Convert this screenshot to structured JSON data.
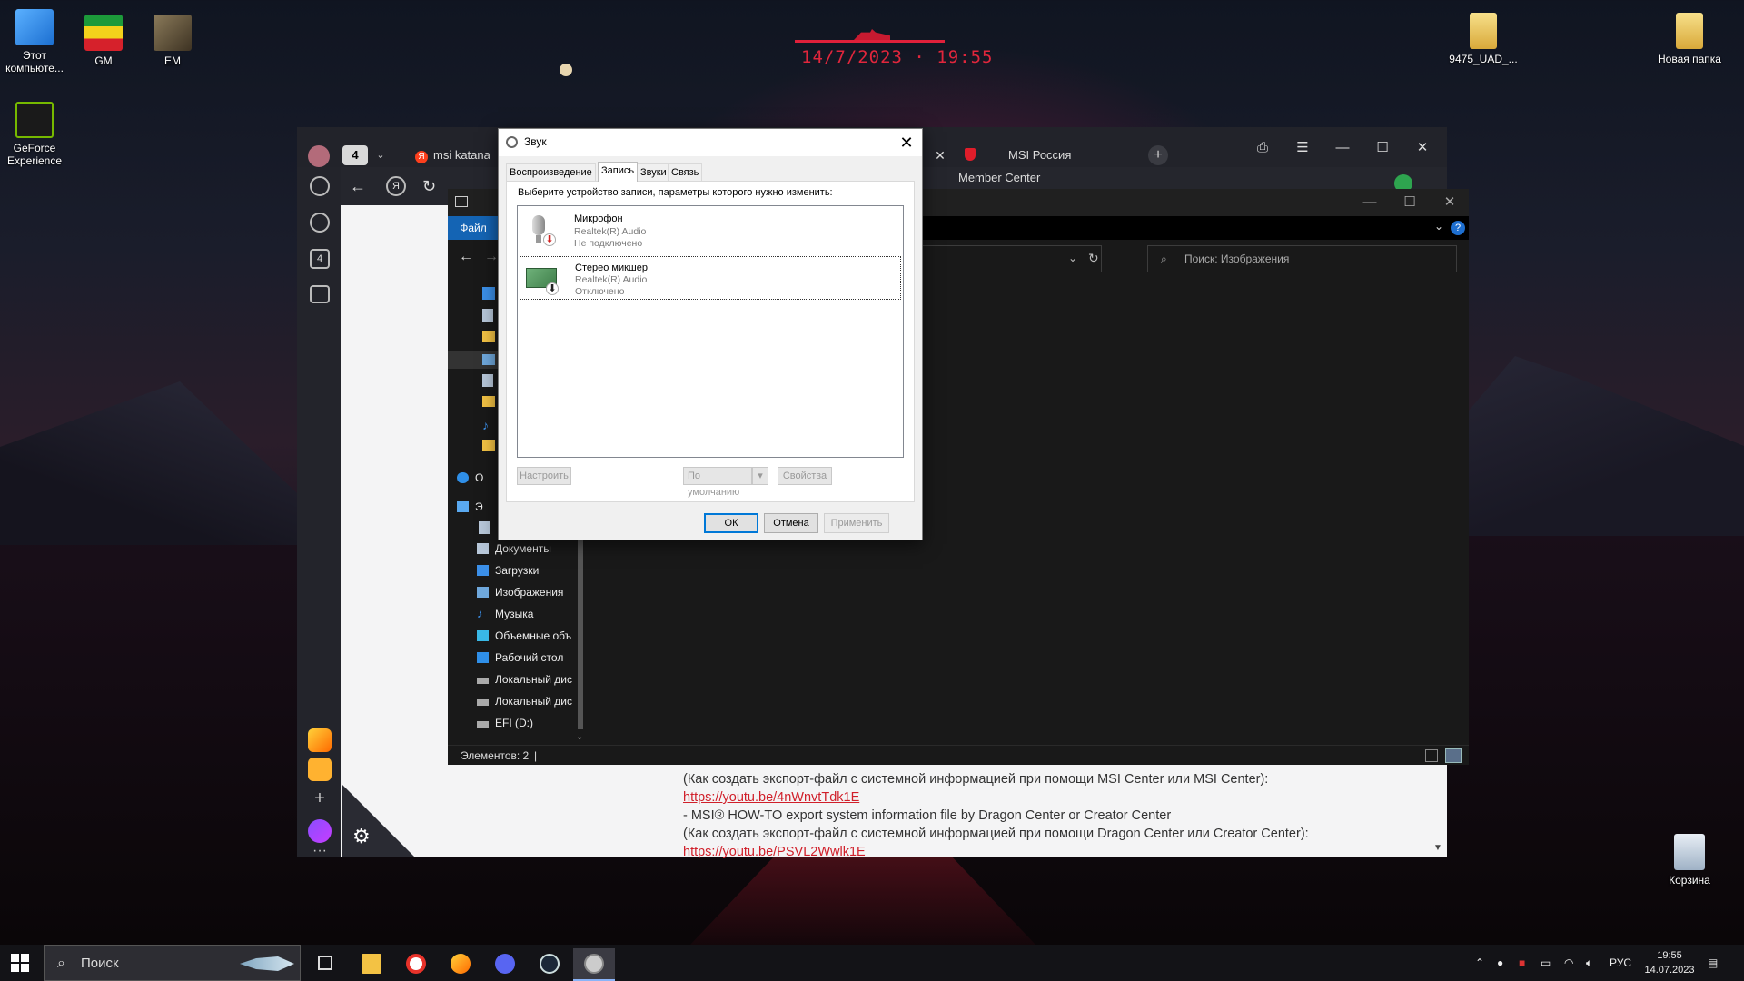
{
  "desktop": {
    "clock": "14/7/2023 · 19:55",
    "icons": [
      {
        "label": "Этот компьюте..."
      },
      {
        "label": "GM"
      },
      {
        "label": "EM"
      },
      {
        "label": "GeForce Experience"
      },
      {
        "label": "9475_UAD_..."
      },
      {
        "label": "Новая папка"
      },
      {
        "label": "Корзина"
      }
    ]
  },
  "browser": {
    "tab_count": "4",
    "tabs": [
      {
        "label": "msi katana"
      },
      {
        "label": "MSI Россия"
      }
    ],
    "partial_tab": "Member Center",
    "sidebar_badge": "4",
    "page_lines": [
      {
        "text": "(Как создать экспорт-файл с системной информацией при помощи MSI Center или MSI Center):",
        "link": false
      },
      {
        "text": "https://youtu.be/4nWnvtTdk1E",
        "link": true
      },
      {
        "text": "- MSI® HOW-TO export system information file by Dragon Center or Creator Center",
        "link": false
      },
      {
        "text": "(Как создать экспорт-файл с системной информацией при помощи Dragon Center или Creator Center):",
        "link": false
      },
      {
        "text": "https://youtu.be/PSVL2Wwlk1E",
        "link": true
      }
    ]
  },
  "explorer": {
    "file_tab": "Файл",
    "search_placeholder": "Поиск: Изображения",
    "tree": [
      {
        "label": "О"
      },
      {
        "label": "Э"
      },
      {
        "label": "Документы"
      },
      {
        "label": "Загрузки"
      },
      {
        "label": "Изображения"
      },
      {
        "label": "Музыка"
      },
      {
        "label": "Объемные объ"
      },
      {
        "label": "Рабочий стол"
      },
      {
        "label": "Локальный дис"
      },
      {
        "label": "Локальный дис"
      },
      {
        "label": "EFI (D:)"
      }
    ],
    "status": "Элементов: 2"
  },
  "dialog": {
    "title": "Звук",
    "tabs": [
      "Воспроизведение",
      "Запись",
      "Звуки",
      "Связь"
    ],
    "active_tab": "Запись",
    "hint": "Выберите устройство записи, параметры которого нужно изменить:",
    "devices": [
      {
        "name": "Микрофон",
        "driver": "Realtek(R) Audio",
        "state": "Не подключено"
      },
      {
        "name": "Стерео микшер",
        "driver": "Realtek(R) Audio",
        "state": "Отключено"
      }
    ],
    "configure_btn": "Настроить",
    "default_btn": "По умолчанию",
    "properties_btn": "Свойства",
    "ok_btn": "ОК",
    "cancel_btn": "Отмена",
    "apply_btn": "Применить"
  },
  "taskbar": {
    "search_placeholder": "Поиск",
    "lang": "РУС",
    "time": "19:55",
    "date": "14.07.2023"
  },
  "colors": {
    "accent_blue": "#0078d7",
    "file_tab_blue": "#1464b4",
    "link_red": "#d01f2a",
    "clock_red": "#e1263c"
  }
}
